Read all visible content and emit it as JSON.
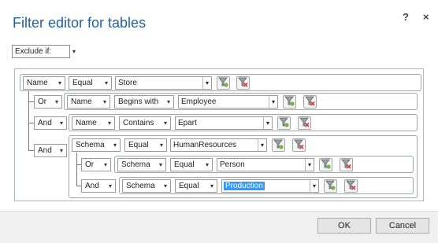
{
  "dialog": {
    "title": "Filter editor for tables",
    "help_label": "?",
    "close_label": "×"
  },
  "exclude": {
    "value": "Exclude if:"
  },
  "rows": {
    "r1": {
      "field": "Name",
      "operator": "Equal",
      "value": "Store"
    },
    "r2": {
      "logic": "Or",
      "field": "Name",
      "operator": "Begins with",
      "value": "Employee"
    },
    "r3": {
      "logic": "And",
      "field": "Name",
      "operator": "Contains",
      "value": "Epart"
    },
    "r4": {
      "logic": "And",
      "field": "Schema",
      "operator": "Equal",
      "value": "HumanResources"
    },
    "r5": {
      "logic": "Or",
      "field": "Schema",
      "operator": "Equal",
      "value": "Person"
    },
    "r6": {
      "logic": "And",
      "field": "Schema",
      "operator": "Equal",
      "value": "Production"
    }
  },
  "icons": {
    "dropdown": "▾",
    "add_filter": "add-filter-icon",
    "remove_filter": "remove-filter-icon"
  },
  "buttons": {
    "ok": "OK",
    "cancel": "Cancel"
  },
  "colors": {
    "title": "#1f63a7",
    "selection": "#3399ff",
    "funnel_add": "#7bb342",
    "funnel_remove": "#d23c3c"
  }
}
